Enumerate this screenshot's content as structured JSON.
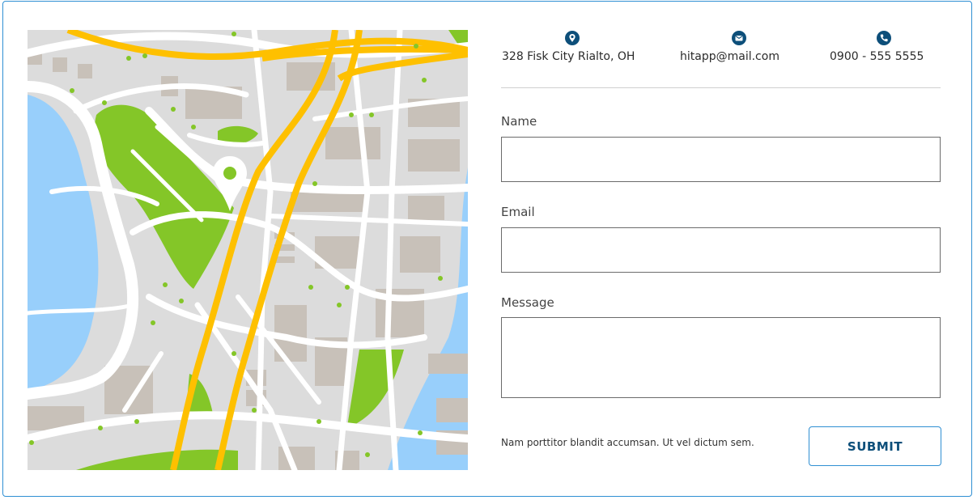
{
  "contact": {
    "address": "328 Fisk City Rialto, OH",
    "email": "hitapp@mail.com",
    "phone": "0900 - 555 5555"
  },
  "icons": {
    "address": "location-pin-icon",
    "email": "envelope-icon",
    "phone": "phone-icon"
  },
  "form": {
    "name_label": "Name",
    "name_value": "",
    "email_label": "Email",
    "email_value": "",
    "message_label": "Message",
    "message_value": ""
  },
  "footer_note": "Nam porttitor blandit accumsan. Ut vel dictum sem.",
  "submit_label": "SUBMIT",
  "colors": {
    "accent": "#0d4f7a",
    "border": "#2f8fd3",
    "map_water": "#98cffb",
    "map_park": "#84c628",
    "map_road_major": "#fec000",
    "map_block": "#dcdcdc",
    "map_building": "#c8c1b9"
  }
}
